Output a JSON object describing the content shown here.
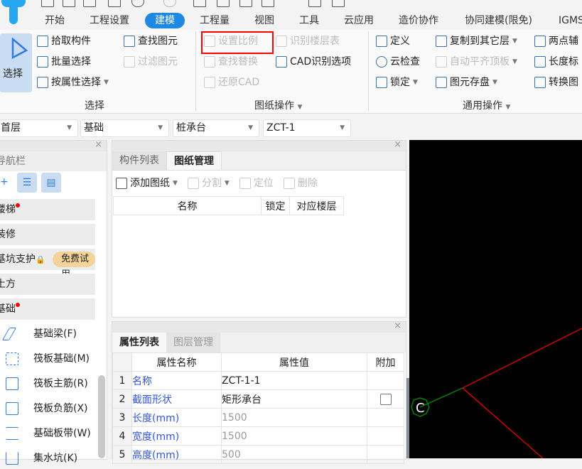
{
  "ribbon": {
    "tabs": [
      "开始",
      "工程设置",
      "建模",
      "工程量",
      "视图",
      "工具",
      "云应用",
      "造价协作",
      "协同建模(限免)",
      "IGMS"
    ],
    "active_tab": "建模",
    "select_group": {
      "big_button": "选择",
      "items": [
        "拾取构件",
        "批量选择",
        "按属性选择",
        "查找图元",
        "过滤图元"
      ],
      "label": "选择"
    },
    "drawing_group": {
      "items": [
        "设置比例",
        "查找替换",
        "还原CAD",
        "识别楼层表",
        "CAD识别选项"
      ],
      "label": "图纸操作",
      "highlighted": "设置比例"
    },
    "common_group": {
      "items": [
        "定义",
        "云检查",
        "锁定",
        "复制到其它层",
        "自动平齐顶板",
        "图元存盘",
        "两点辅",
        "长度标",
        "转换图"
      ],
      "label": "通用操作"
    }
  },
  "selectors": {
    "floor": "首层",
    "category": "基础",
    "type": "桩承台",
    "component": "ZCT-1"
  },
  "nav": {
    "title": "导航栏",
    "items": [
      {
        "label": "楼梯",
        "dot": true
      },
      {
        "label": "装修",
        "dot": false
      },
      {
        "label": "基坑支护",
        "dot": false,
        "badge": "免费试用",
        "locked": true
      },
      {
        "label": "土方",
        "dot": false
      },
      {
        "label": "基础",
        "dot": true
      }
    ],
    "sub_items": [
      "基础梁(F)",
      "筏板基础(M)",
      "筏板主筋(R)",
      "筏板负筋(X)",
      "基础板带(W)",
      "集水坑(K)"
    ]
  },
  "drawing_panel": {
    "tabs": [
      "构件列表",
      "图纸管理"
    ],
    "active_tab": "图纸管理",
    "toolbar": [
      "添加图纸",
      "分割",
      "定位",
      "删除"
    ],
    "columns": [
      "名称",
      "锁定",
      "对应楼层"
    ]
  },
  "property_panel": {
    "tabs": [
      "属性列表",
      "图层管理"
    ],
    "active_tab": "属性列表",
    "columns": [
      "属性名称",
      "属性值",
      "附加"
    ],
    "rows": [
      {
        "n": "1",
        "name": "名称",
        "value": "ZCT-1-1"
      },
      {
        "n": "2",
        "name": "截面形状",
        "value": "矩形承台",
        "checkbox": false
      },
      {
        "n": "3",
        "name": "长度(mm)",
        "value": "1500"
      },
      {
        "n": "4",
        "name": "宽度(mm)",
        "value": "1500"
      },
      {
        "n": "5",
        "name": "高度(mm)",
        "value": "500"
      }
    ]
  },
  "canvas": {
    "axis_label": "C",
    "colors": {
      "background": "#000000",
      "axis": "#008000",
      "line": "#cc0000"
    }
  },
  "colors": {
    "accent": "#1e88e5",
    "highlight": "#ff0000"
  }
}
